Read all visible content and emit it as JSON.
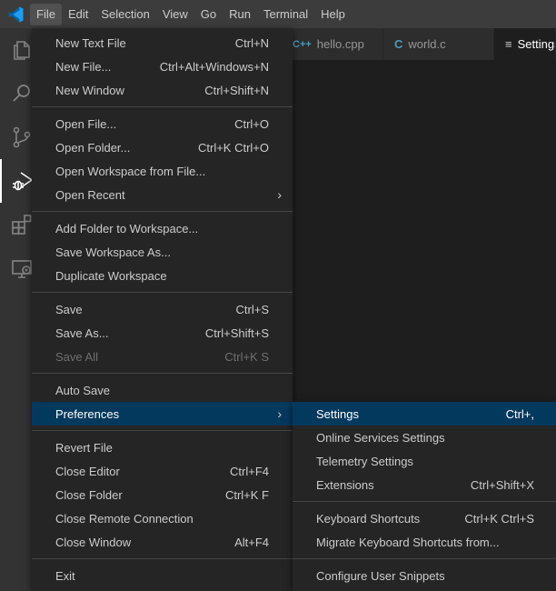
{
  "colors": {
    "accent": "#007acc",
    "highlight": "#04395e",
    "menu_bg": "#252526",
    "titlebar": "#3c3c3c"
  },
  "menubar": {
    "items": [
      "File",
      "Edit",
      "Selection",
      "View",
      "Go",
      "Run",
      "Terminal",
      "Help"
    ]
  },
  "activity_icons": [
    "files-icon",
    "search-icon",
    "source-control-icon",
    "run-debug-icon",
    "extensions-icon",
    "remote-explorer-icon"
  ],
  "tabs": [
    {
      "label": "hello.cpp",
      "icon": "C++"
    },
    {
      "label": "world.c",
      "icon": "C"
    },
    {
      "label": "Settings",
      "icon": "≡"
    }
  ],
  "file_menu": {
    "groups": [
      [
        {
          "label": "New Text File",
          "shortcut": "Ctrl+N"
        },
        {
          "label": "New File...",
          "shortcut": "Ctrl+Alt+Windows+N"
        },
        {
          "label": "New Window",
          "shortcut": "Ctrl+Shift+N"
        }
      ],
      [
        {
          "label": "Open File...",
          "shortcut": "Ctrl+O"
        },
        {
          "label": "Open Folder...",
          "shortcut": "Ctrl+K Ctrl+O"
        },
        {
          "label": "Open Workspace from File...",
          "shortcut": ""
        },
        {
          "label": "Open Recent",
          "shortcut": "",
          "submenu": true
        }
      ],
      [
        {
          "label": "Add Folder to Workspace...",
          "shortcut": ""
        },
        {
          "label": "Save Workspace As...",
          "shortcut": ""
        },
        {
          "label": "Duplicate Workspace",
          "shortcut": ""
        }
      ],
      [
        {
          "label": "Save",
          "shortcut": "Ctrl+S"
        },
        {
          "label": "Save As...",
          "shortcut": "Ctrl+Shift+S"
        },
        {
          "label": "Save All",
          "shortcut": "Ctrl+K S",
          "disabled": true
        }
      ],
      [
        {
          "label": "Auto Save",
          "shortcut": ""
        },
        {
          "label": "Preferences",
          "shortcut": "",
          "submenu": true,
          "highlighted": true
        }
      ],
      [
        {
          "label": "Revert File",
          "shortcut": ""
        },
        {
          "label": "Close Editor",
          "shortcut": "Ctrl+F4"
        },
        {
          "label": "Close Folder",
          "shortcut": "Ctrl+K F"
        },
        {
          "label": "Close Remote Connection",
          "shortcut": ""
        },
        {
          "label": "Close Window",
          "shortcut": "Alt+F4"
        }
      ],
      [
        {
          "label": "Exit",
          "shortcut": ""
        }
      ]
    ]
  },
  "preferences_menu": {
    "groups": [
      [
        {
          "label": "Settings",
          "shortcut": "Ctrl+,",
          "highlighted": true
        },
        {
          "label": "Online Services Settings",
          "shortcut": ""
        },
        {
          "label": "Telemetry Settings",
          "shortcut": ""
        },
        {
          "label": "Extensions",
          "shortcut": "Ctrl+Shift+X"
        }
      ],
      [
        {
          "label": "Keyboard Shortcuts",
          "shortcut": "Ctrl+K Ctrl+S"
        },
        {
          "label": "Migrate Keyboard Shortcuts from...",
          "shortcut": ""
        }
      ],
      [
        {
          "label": "Configure User Snippets",
          "shortcut": ""
        }
      ]
    ]
  }
}
